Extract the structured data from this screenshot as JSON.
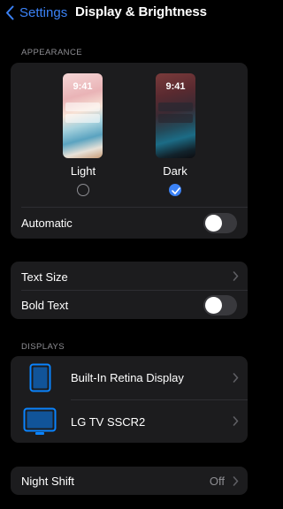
{
  "nav": {
    "back_label": "Settings",
    "title": "Display & Brightness"
  },
  "appearance": {
    "header": "APPEARANCE",
    "light": {
      "time": "9:41",
      "label": "Light",
      "selected": false
    },
    "dark": {
      "time": "9:41",
      "label": "Dark",
      "selected": true
    },
    "automatic_label": "Automatic",
    "automatic_on": false
  },
  "text": {
    "text_size_label": "Text Size",
    "bold_text_label": "Bold Text",
    "bold_text_on": false
  },
  "displays": {
    "header": "DISPLAYS",
    "items": [
      {
        "label": "Built-In Retina Display",
        "icon": "ipad-icon"
      },
      {
        "label": "LG TV SSCR2",
        "icon": "tv-icon"
      }
    ]
  },
  "night_shift": {
    "label": "Night Shift",
    "value": "Off"
  },
  "colors": {
    "accent": "#3b82f6",
    "icon_blue": "#0a84ff",
    "group_bg": "#1c1c1e"
  }
}
